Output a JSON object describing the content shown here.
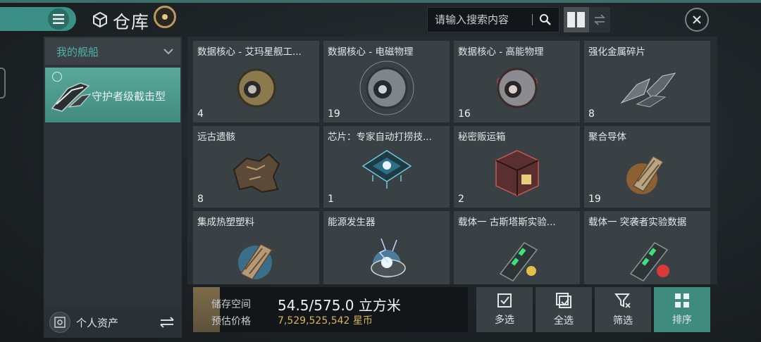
{
  "header": {
    "title": "仓库",
    "search": {
      "placeholder": "请输入搜索内容"
    }
  },
  "sidebar": {
    "dropdown_label": "我的舰船",
    "ship_label": "守护者级截击型",
    "personal_assets_label": "个人资产"
  },
  "items": [
    {
      "name": "数据核心 - 艾玛星舰工...",
      "count": "4",
      "icon": "data-core-gold-icon"
    },
    {
      "name": "数据核心 - 电磁物理",
      "count": "19",
      "icon": "data-core-silver-icon"
    },
    {
      "name": "数据核心 - 高能物理",
      "count": "16",
      "icon": "data-core-red-icon"
    },
    {
      "name": "强化金属碎片",
      "count": "8",
      "icon": "metal-fragment-icon"
    },
    {
      "name": "远古遗骸",
      "count": "8",
      "icon": "ancient-relic-icon"
    },
    {
      "name": "芯片：专家自动打捞技...",
      "count": "1",
      "icon": "chip-icon"
    },
    {
      "name": "秘密贩运箱",
      "count": "2",
      "icon": "cargo-box-icon"
    },
    {
      "name": "聚合导体",
      "count": "19",
      "icon": "conductor-icon"
    },
    {
      "name": "集成热塑塑料",
      "count": "",
      "icon": "thermoplastic-icon"
    },
    {
      "name": "能源发生器",
      "count": "",
      "icon": "energy-generator-icon"
    },
    {
      "name": "载体一 古斯塔斯实验...",
      "count": "",
      "icon": "carrier-gustas-icon"
    },
    {
      "name": "载体一 突袭者实验数据",
      "count": "",
      "icon": "carrier-raider-icon"
    }
  ],
  "storage": {
    "space_label": "储存空间",
    "space_value": "54.5/575.0 立方米",
    "price_label": "预估价格",
    "price_value": "7,529,525,542 星币"
  },
  "actions": {
    "multi_select": "多选",
    "select_all": "全选",
    "filter": "筛选",
    "sort": "排序"
  },
  "colors": {
    "accent": "#3f8c7f",
    "currency": "#d8b55b",
    "tab_label": "#4fb3a6"
  }
}
